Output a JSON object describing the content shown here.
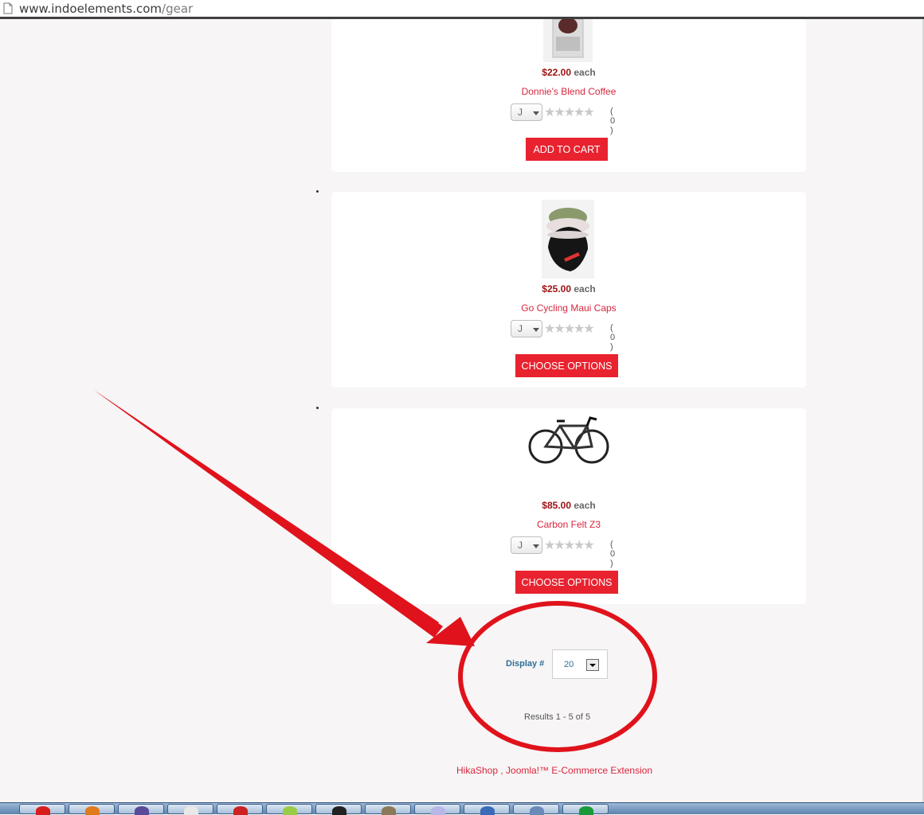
{
  "browser": {
    "url_domain": "www.indoelements.com",
    "url_path": "/gear"
  },
  "products": [
    {
      "price": "$22.00",
      "unit": "each",
      "name": "Donnie's Blend Coffee",
      "vote_value": "J",
      "stars": "★★★★★",
      "votes": "( 0 )",
      "button": "ADD TO CART",
      "image_icon": "coffee-bag-image"
    },
    {
      "price": "$25.00",
      "unit": "each",
      "name": "Go Cycling Maui Caps",
      "vote_value": "J",
      "stars": "★★★★★",
      "votes": "( 0 )",
      "button": "CHOOSE OPTIONS",
      "image_icon": "cap-image"
    },
    {
      "price": "$85.00",
      "unit": "each",
      "name": "Carbon Felt Z3",
      "vote_value": "J",
      "stars": "★★★★★",
      "votes": "( 0 )",
      "button": "CHOOSE OPTIONS",
      "image_icon": "bicycle-image"
    }
  ],
  "pagination": {
    "display_label": "Display #",
    "limit_value": "20",
    "results": "Results 1 - 5 of 5"
  },
  "footer": {
    "link": "HikaShop , Joomla!™ E-Commerce Extension"
  },
  "colors": {
    "accent": "#e8232f",
    "price": "#9a1111",
    "link": "#d7263d",
    "annotation": "#e0121b"
  }
}
